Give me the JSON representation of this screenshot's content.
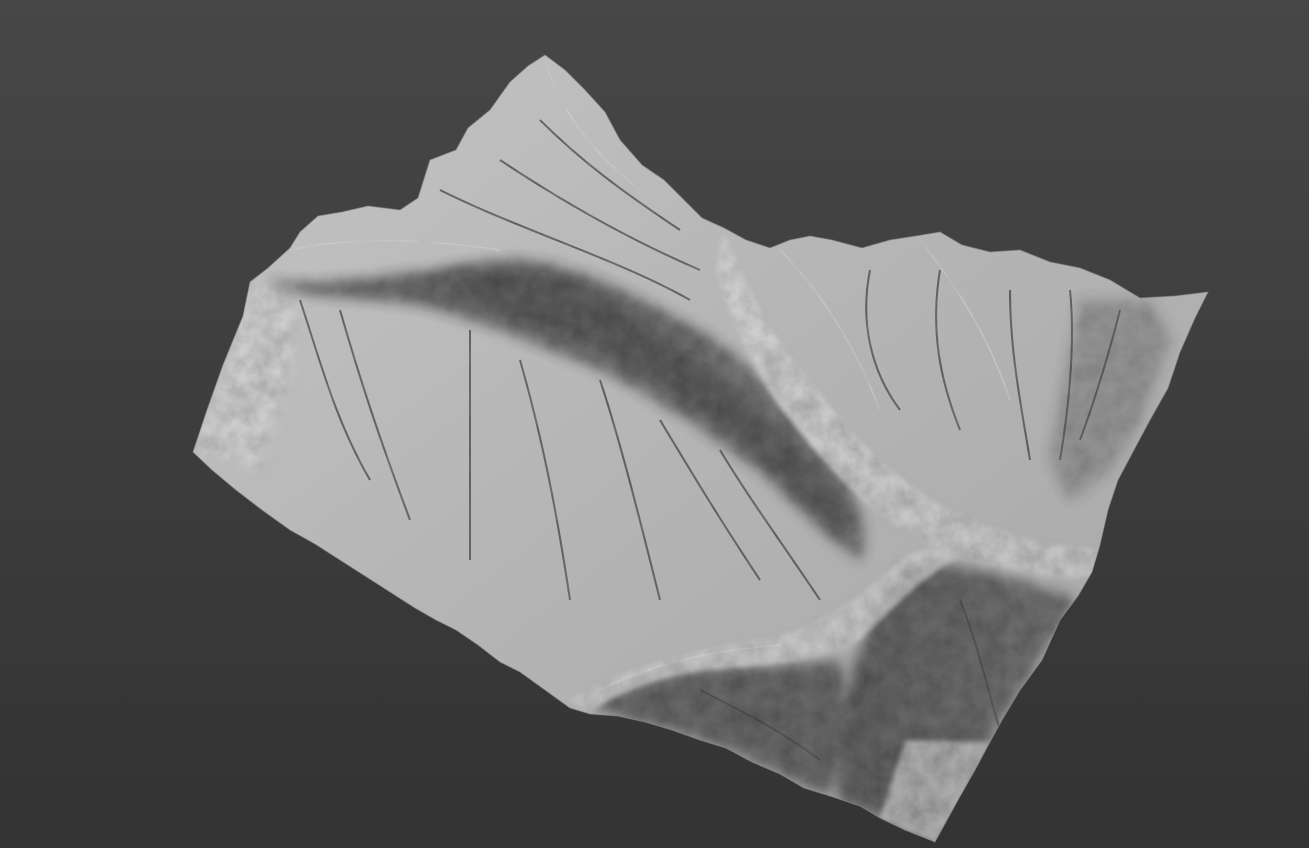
{
  "viewport": {
    "background_top": "#474747",
    "background_bottom": "#333333"
  },
  "model": {
    "material_color": "#b9b9b9",
    "highlight_color": "#cfcfcf",
    "shadow_color": "#5e5e5e",
    "deep_shadow_color": "#4a4a4a"
  }
}
